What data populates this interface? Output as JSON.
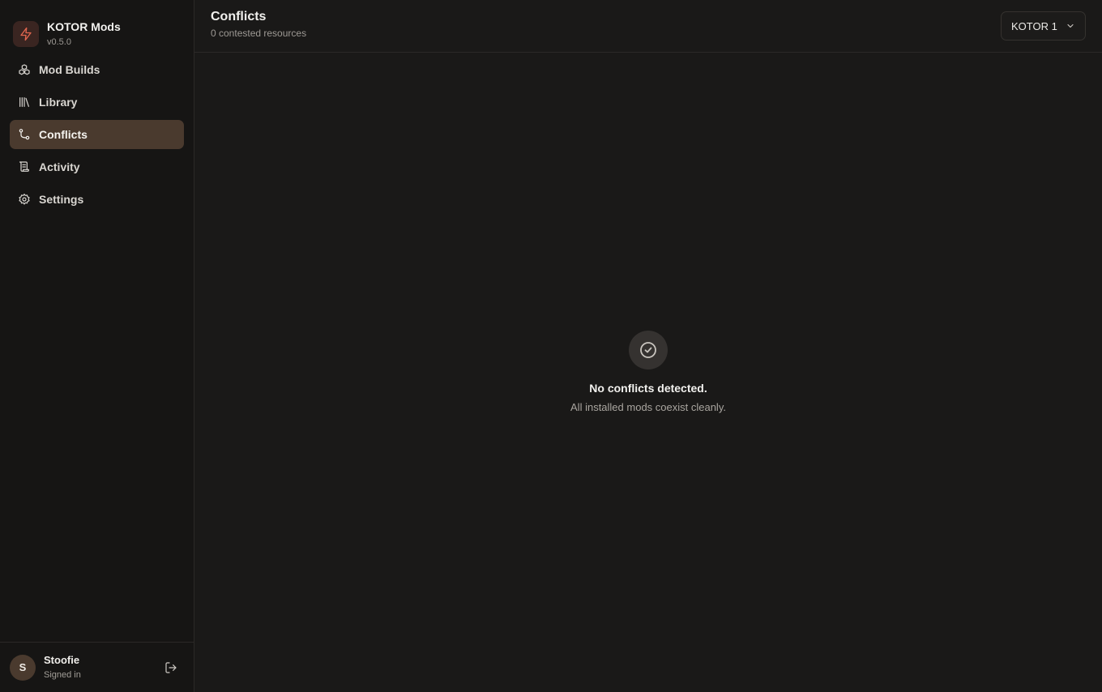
{
  "brand": {
    "title": "KOTOR Mods",
    "version": "v0.5.0",
    "icon": "lightning-bolt-icon",
    "accent": "#e0664f"
  },
  "sidebar": {
    "items": [
      {
        "label": "Mod Builds",
        "icon": "boxes-icon",
        "active": false
      },
      {
        "label": "Library",
        "icon": "library-icon",
        "active": false
      },
      {
        "label": "Conflicts",
        "icon": "git-branch-icon",
        "active": true
      },
      {
        "label": "Activity",
        "icon": "scroll-icon",
        "active": false
      },
      {
        "label": "Settings",
        "icon": "gear-icon",
        "active": false
      }
    ]
  },
  "user": {
    "initial": "S",
    "name": "Stoofie",
    "status": "Signed in",
    "logout_icon": "logout-icon"
  },
  "header": {
    "title": "Conflicts",
    "subtitle": "0 contested resources",
    "game_select": {
      "value": "KOTOR 1",
      "icon": "chevron-down-icon"
    }
  },
  "empty_state": {
    "icon": "check-circle-icon",
    "title": "No conflicts detected.",
    "message": "All installed mods coexist cleanly."
  },
  "colors": {
    "background": "#1a1918",
    "sidebar": "#161514",
    "active_item": "#4a3a2e",
    "border": "#2b2927"
  }
}
